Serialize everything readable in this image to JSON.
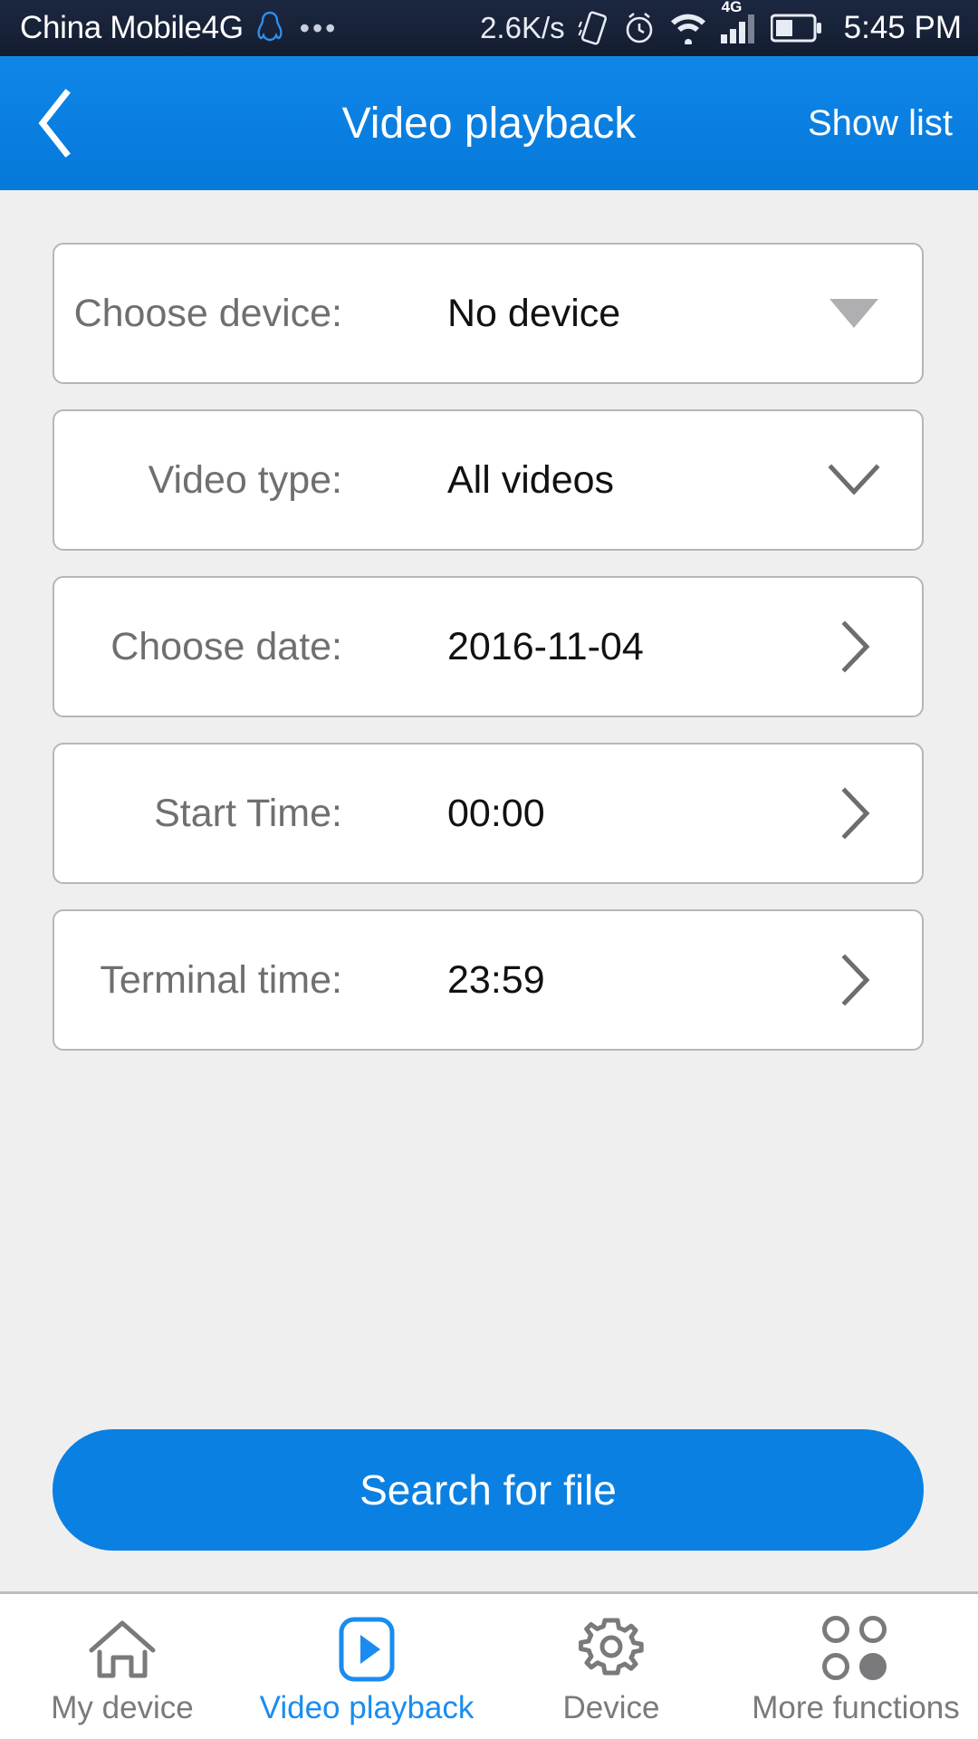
{
  "status_bar": {
    "carrier": "China Mobile4G",
    "qq_icon": "qq-penguin-icon",
    "overflow_icon": "more-dots-icon",
    "network_speed": "2.6K/s",
    "vibrate_icon": "vibrate-icon",
    "alarm_icon": "alarm-clock-icon",
    "wifi_icon": "wifi-icon",
    "signal_label": "4G",
    "signal_icon": "signal-bars-icon",
    "battery_icon": "battery-icon",
    "time": "5:45 PM"
  },
  "header": {
    "back_icon": "back-chevron-icon",
    "title": "Video playback",
    "action_label": "Show list",
    "background_color": "#0a80e2"
  },
  "form": {
    "rows": [
      {
        "label": "Choose device:",
        "value": "No device",
        "icon": "triangle-down-icon"
      },
      {
        "label": "Video type:",
        "value": "All videos",
        "icon": "chevron-down-icon"
      },
      {
        "label": "Choose date:",
        "value": "2016-11-04",
        "icon": "chevron-right-icon"
      },
      {
        "label": "Start Time:",
        "value": "00:00",
        "icon": "chevron-right-icon"
      },
      {
        "label": "Terminal time:",
        "value": "23:59",
        "icon": "chevron-right-icon"
      }
    ]
  },
  "search_button": {
    "label": "Search for file",
    "color": "#0a80e2"
  },
  "bottom_nav": {
    "active_color": "#1a8cf0",
    "inactive_color": "#7a7a7d",
    "items": [
      {
        "label": "My device",
        "icon": "home-icon",
        "active": false
      },
      {
        "label": "Video playback",
        "icon": "play-square-icon",
        "active": true
      },
      {
        "label": "Device",
        "icon": "gear-icon",
        "active": false
      },
      {
        "label": "More functions",
        "icon": "four-circles-icon",
        "active": false
      }
    ]
  }
}
